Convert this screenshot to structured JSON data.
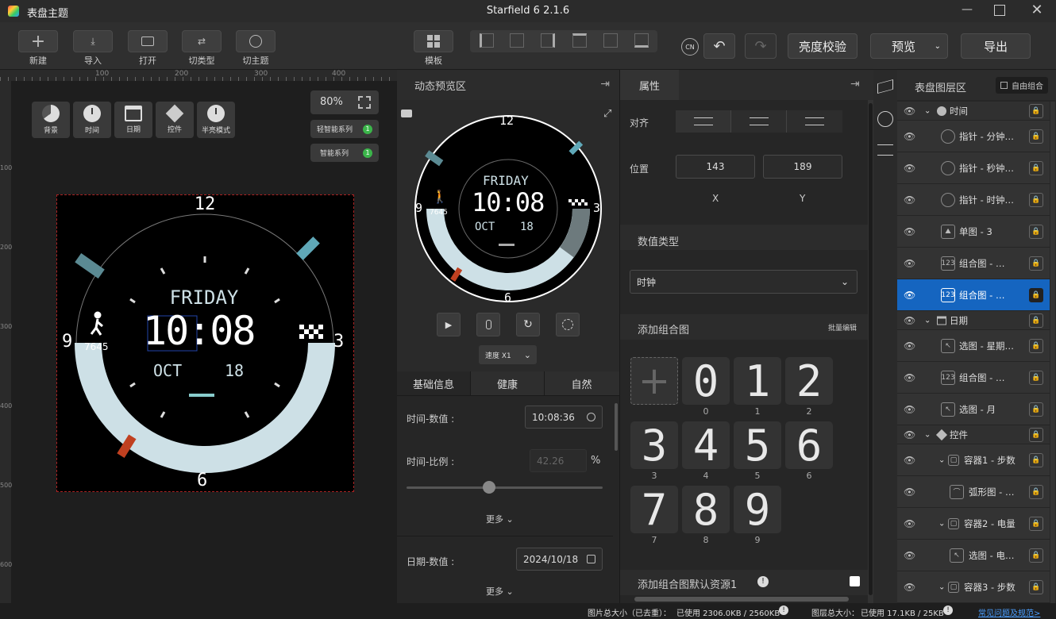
{
  "window": {
    "title": "表盘主题",
    "app_title": "Starfield 6 2.1.6"
  },
  "toolbar": {
    "new": "新建",
    "import": "导入",
    "open": "打开",
    "switch_type": "切类型",
    "switch_theme": "切主题",
    "template": "模板",
    "align": "对齐",
    "lang": "CN",
    "brightness": "亮度校验",
    "preview": "预览",
    "export": "导出"
  },
  "canvas": {
    "zoom": "80%",
    "ruler_labels": [
      "100",
      "200",
      "300",
      "400"
    ],
    "ruler_v_labels": [
      "100",
      "200",
      "300",
      "400",
      "500",
      "600"
    ],
    "tools": [
      "背景",
      "时间",
      "日期",
      "控件",
      "半亮模式"
    ],
    "light_series": "轻智能系列",
    "smart_series": "智能系列",
    "badge1": "1",
    "badge2": "1"
  },
  "watch": {
    "day": "FRIDAY",
    "time": "10:08",
    "month": "OCT",
    "date": "18",
    "steps": "7645",
    "n12": "12",
    "n3": "3",
    "n6": "6",
    "n9": "9"
  },
  "preview": {
    "title": "动态预览区",
    "speed": "速度 X1"
  },
  "info_tabs": [
    "基础信息",
    "健康",
    "自然"
  ],
  "info": {
    "time_value_label": "时间-数值 :",
    "time_value": "10:08:36",
    "time_ratio_label": "时间-比例 :",
    "time_ratio": "42.26",
    "time_ratio_unit": "%",
    "time_ratio_pct": 42.26,
    "more": "更多",
    "date_value_label": "日期-数值 :",
    "date_value": "2024/10/18",
    "more2": "更多"
  },
  "props": {
    "title": "属性",
    "align_label": "对齐",
    "pos_label": "位置",
    "x": "143",
    "y": "189",
    "x_label": "X",
    "y_label": "Y",
    "value_type_label": "数值类型",
    "value_type": "时钟",
    "add_group": "添加组合图",
    "batch_edit": "批量编辑",
    "digits": [
      "0",
      "1",
      "2",
      "3",
      "4",
      "5",
      "6",
      "7",
      "8",
      "9"
    ],
    "default_res": "添加组合图默认资源1"
  },
  "layers": {
    "title": "表盘图层区",
    "free_group": "自由组合",
    "groups": {
      "time": "时间",
      "date": "日期",
      "widget": "控件"
    },
    "items": [
      "指针 - 分钟…",
      "指针 - 秒钟…",
      "指针 - 时钟…",
      "单图 - 3",
      "组合图 - …",
      "组合图 - …",
      "选图 - 星期…",
      "组合图 - …",
      "选图 - 月",
      "容器1 - 步数",
      "弧形图 - …",
      "容器2 - 电量",
      "选图 - 电…",
      "容器3 - 步数"
    ]
  },
  "status": {
    "img_size_label": "图片总大小（已去重）：",
    "img_size": "已使用 2306.0KB / 2560KB",
    "layer_size_label": "图层总大小：",
    "layer_size": "已使用 17.1KB / 25KB",
    "faq": "常见问题及规范>"
  }
}
